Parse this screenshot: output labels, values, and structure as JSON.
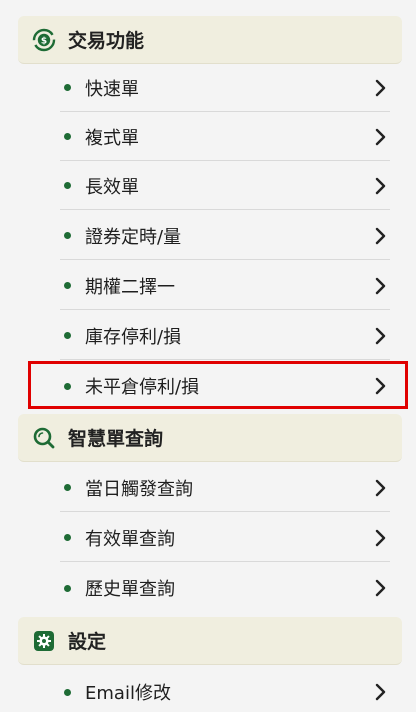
{
  "colors": {
    "accent_green": "#1e6b35",
    "section_bg": "#f0eedf",
    "highlight_red": "#e00000"
  },
  "sections": [
    {
      "title": "交易功能",
      "icon": "dollar-cycle-icon",
      "items": [
        {
          "label": "快速單"
        },
        {
          "label": "複式單"
        },
        {
          "label": "長效單"
        },
        {
          "label": "證券定時/量"
        },
        {
          "label": "期權二擇一"
        },
        {
          "label": "庫存停利/損"
        },
        {
          "label": "未平倉停利/損"
        }
      ]
    },
    {
      "title": "智慧單查詢",
      "icon": "search-icon",
      "items": [
        {
          "label": "當日觸發查詢"
        },
        {
          "label": "有效單查詢"
        },
        {
          "label": "歷史單查詢"
        }
      ]
    },
    {
      "title": "設定",
      "icon": "gear-icon",
      "items": [
        {
          "label": "Email修改"
        }
      ]
    }
  ],
  "chevron_icon": "chevron-right-icon"
}
